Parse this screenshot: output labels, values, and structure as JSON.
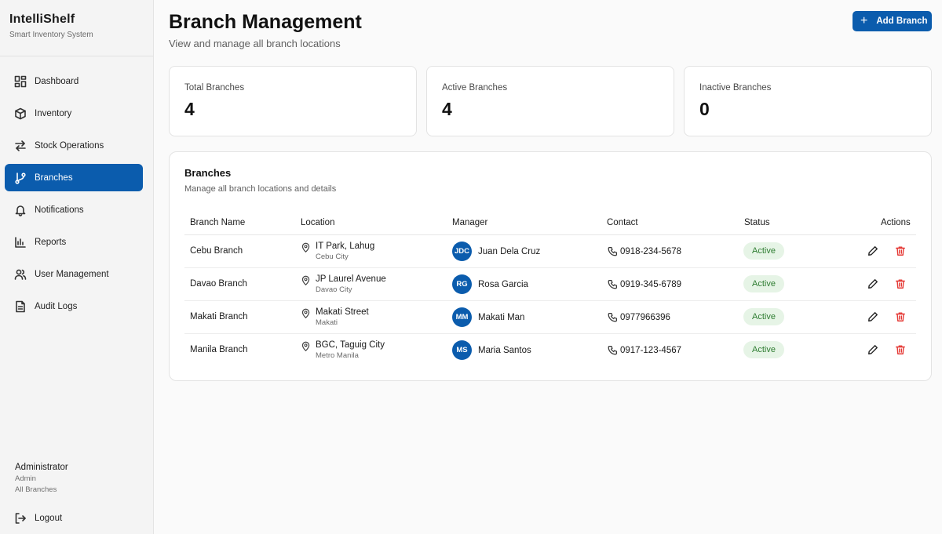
{
  "app": {
    "name": "IntelliShelf",
    "subtitle": "Smart Inventory System"
  },
  "sidebar": {
    "items": [
      {
        "label": "Dashboard",
        "icon": "dashboard-icon",
        "active": false
      },
      {
        "label": "Inventory",
        "icon": "box-icon",
        "active": false
      },
      {
        "label": "Stock Operations",
        "icon": "swap-arrows-icon",
        "active": false
      },
      {
        "label": "Branches",
        "icon": "branch-icon",
        "active": true
      },
      {
        "label": "Notifications",
        "icon": "bell-icon",
        "active": false
      },
      {
        "label": "Reports",
        "icon": "bar-chart-icon",
        "active": false
      },
      {
        "label": "User Management",
        "icon": "users-icon",
        "active": false
      },
      {
        "label": "Audit Logs",
        "icon": "document-icon",
        "active": false
      }
    ],
    "user": {
      "name": "Administrator",
      "role": "Admin",
      "branch": "All Branches"
    },
    "logout_label": "Logout"
  },
  "header": {
    "title": "Branch Management",
    "subtitle": "View and manage all branch locations",
    "add_button_label": "Add Branch"
  },
  "stats": [
    {
      "label": "Total Branches",
      "value": "4"
    },
    {
      "label": "Active Branches",
      "value": "4"
    },
    {
      "label": "Inactive Branches",
      "value": "0"
    }
  ],
  "table": {
    "title": "Branches",
    "subtitle": "Manage all branch locations and details",
    "columns": [
      "Branch Name",
      "Location",
      "Manager",
      "Contact",
      "Status",
      "Actions"
    ],
    "rows": [
      {
        "name": "Cebu Branch",
        "location": "IT Park, Lahug",
        "city": "Cebu City",
        "initials": "JDC",
        "manager": "Juan Dela Cruz",
        "contact": "0918-234-5678",
        "status": "Active"
      },
      {
        "name": "Davao Branch",
        "location": "JP Laurel Avenue",
        "city": "Davao City",
        "initials": "RG",
        "manager": "Rosa Garcia",
        "contact": "0919-345-6789",
        "status": "Active"
      },
      {
        "name": "Makati Branch",
        "location": "Makati Street",
        "city": "Makati",
        "initials": "MM",
        "manager": "Makati Man",
        "contact": "0977966396",
        "status": "Active"
      },
      {
        "name": "Manila Branch",
        "location": "BGC, Taguig City",
        "city": "Metro Manila",
        "initials": "MS",
        "manager": "Maria Santos",
        "contact": "0917-123-4567",
        "status": "Active"
      }
    ]
  },
  "colors": {
    "primary": "#0b5cad",
    "active_badge_bg": "#e6f4e6",
    "active_badge_text": "#2f7d32",
    "danger": "#e53935"
  }
}
